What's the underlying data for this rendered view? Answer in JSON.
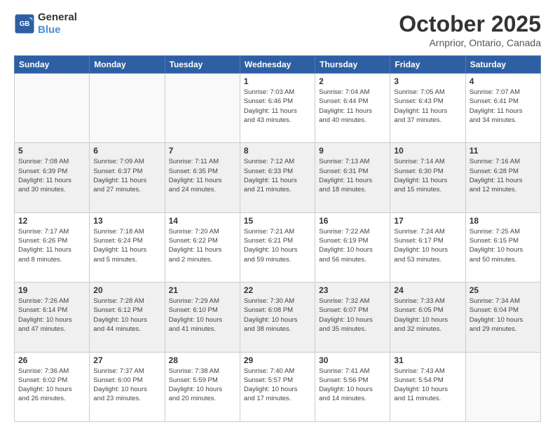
{
  "header": {
    "logo_line1": "General",
    "logo_line2": "Blue",
    "month": "October 2025",
    "location": "Arnprior, Ontario, Canada"
  },
  "days_of_week": [
    "Sunday",
    "Monday",
    "Tuesday",
    "Wednesday",
    "Thursday",
    "Friday",
    "Saturday"
  ],
  "weeks": [
    [
      {
        "num": "",
        "info": ""
      },
      {
        "num": "",
        "info": ""
      },
      {
        "num": "",
        "info": ""
      },
      {
        "num": "1",
        "info": "Sunrise: 7:03 AM\nSunset: 6:46 PM\nDaylight: 11 hours\nand 43 minutes."
      },
      {
        "num": "2",
        "info": "Sunrise: 7:04 AM\nSunset: 6:44 PM\nDaylight: 11 hours\nand 40 minutes."
      },
      {
        "num": "3",
        "info": "Sunrise: 7:05 AM\nSunset: 6:43 PM\nDaylight: 11 hours\nand 37 minutes."
      },
      {
        "num": "4",
        "info": "Sunrise: 7:07 AM\nSunset: 6:41 PM\nDaylight: 11 hours\nand 34 minutes."
      }
    ],
    [
      {
        "num": "5",
        "info": "Sunrise: 7:08 AM\nSunset: 6:39 PM\nDaylight: 11 hours\nand 30 minutes."
      },
      {
        "num": "6",
        "info": "Sunrise: 7:09 AM\nSunset: 6:37 PM\nDaylight: 11 hours\nand 27 minutes."
      },
      {
        "num": "7",
        "info": "Sunrise: 7:11 AM\nSunset: 6:35 PM\nDaylight: 11 hours\nand 24 minutes."
      },
      {
        "num": "8",
        "info": "Sunrise: 7:12 AM\nSunset: 6:33 PM\nDaylight: 11 hours\nand 21 minutes."
      },
      {
        "num": "9",
        "info": "Sunrise: 7:13 AM\nSunset: 6:31 PM\nDaylight: 11 hours\nand 18 minutes."
      },
      {
        "num": "10",
        "info": "Sunrise: 7:14 AM\nSunset: 6:30 PM\nDaylight: 11 hours\nand 15 minutes."
      },
      {
        "num": "11",
        "info": "Sunrise: 7:16 AM\nSunset: 6:28 PM\nDaylight: 11 hours\nand 12 minutes."
      }
    ],
    [
      {
        "num": "12",
        "info": "Sunrise: 7:17 AM\nSunset: 6:26 PM\nDaylight: 11 hours\nand 8 minutes."
      },
      {
        "num": "13",
        "info": "Sunrise: 7:18 AM\nSunset: 6:24 PM\nDaylight: 11 hours\nand 5 minutes."
      },
      {
        "num": "14",
        "info": "Sunrise: 7:20 AM\nSunset: 6:22 PM\nDaylight: 11 hours\nand 2 minutes."
      },
      {
        "num": "15",
        "info": "Sunrise: 7:21 AM\nSunset: 6:21 PM\nDaylight: 10 hours\nand 59 minutes."
      },
      {
        "num": "16",
        "info": "Sunrise: 7:22 AM\nSunset: 6:19 PM\nDaylight: 10 hours\nand 56 minutes."
      },
      {
        "num": "17",
        "info": "Sunrise: 7:24 AM\nSunset: 6:17 PM\nDaylight: 10 hours\nand 53 minutes."
      },
      {
        "num": "18",
        "info": "Sunrise: 7:25 AM\nSunset: 6:15 PM\nDaylight: 10 hours\nand 50 minutes."
      }
    ],
    [
      {
        "num": "19",
        "info": "Sunrise: 7:26 AM\nSunset: 6:14 PM\nDaylight: 10 hours\nand 47 minutes."
      },
      {
        "num": "20",
        "info": "Sunrise: 7:28 AM\nSunset: 6:12 PM\nDaylight: 10 hours\nand 44 minutes."
      },
      {
        "num": "21",
        "info": "Sunrise: 7:29 AM\nSunset: 6:10 PM\nDaylight: 10 hours\nand 41 minutes."
      },
      {
        "num": "22",
        "info": "Sunrise: 7:30 AM\nSunset: 6:08 PM\nDaylight: 10 hours\nand 38 minutes."
      },
      {
        "num": "23",
        "info": "Sunrise: 7:32 AM\nSunset: 6:07 PM\nDaylight: 10 hours\nand 35 minutes."
      },
      {
        "num": "24",
        "info": "Sunrise: 7:33 AM\nSunset: 6:05 PM\nDaylight: 10 hours\nand 32 minutes."
      },
      {
        "num": "25",
        "info": "Sunrise: 7:34 AM\nSunset: 6:04 PM\nDaylight: 10 hours\nand 29 minutes."
      }
    ],
    [
      {
        "num": "26",
        "info": "Sunrise: 7:36 AM\nSunset: 6:02 PM\nDaylight: 10 hours\nand 26 minutes."
      },
      {
        "num": "27",
        "info": "Sunrise: 7:37 AM\nSunset: 6:00 PM\nDaylight: 10 hours\nand 23 minutes."
      },
      {
        "num": "28",
        "info": "Sunrise: 7:38 AM\nSunset: 5:59 PM\nDaylight: 10 hours\nand 20 minutes."
      },
      {
        "num": "29",
        "info": "Sunrise: 7:40 AM\nSunset: 5:57 PM\nDaylight: 10 hours\nand 17 minutes."
      },
      {
        "num": "30",
        "info": "Sunrise: 7:41 AM\nSunset: 5:56 PM\nDaylight: 10 hours\nand 14 minutes."
      },
      {
        "num": "31",
        "info": "Sunrise: 7:43 AM\nSunset: 5:54 PM\nDaylight: 10 hours\nand 11 minutes."
      },
      {
        "num": "",
        "info": ""
      }
    ]
  ]
}
